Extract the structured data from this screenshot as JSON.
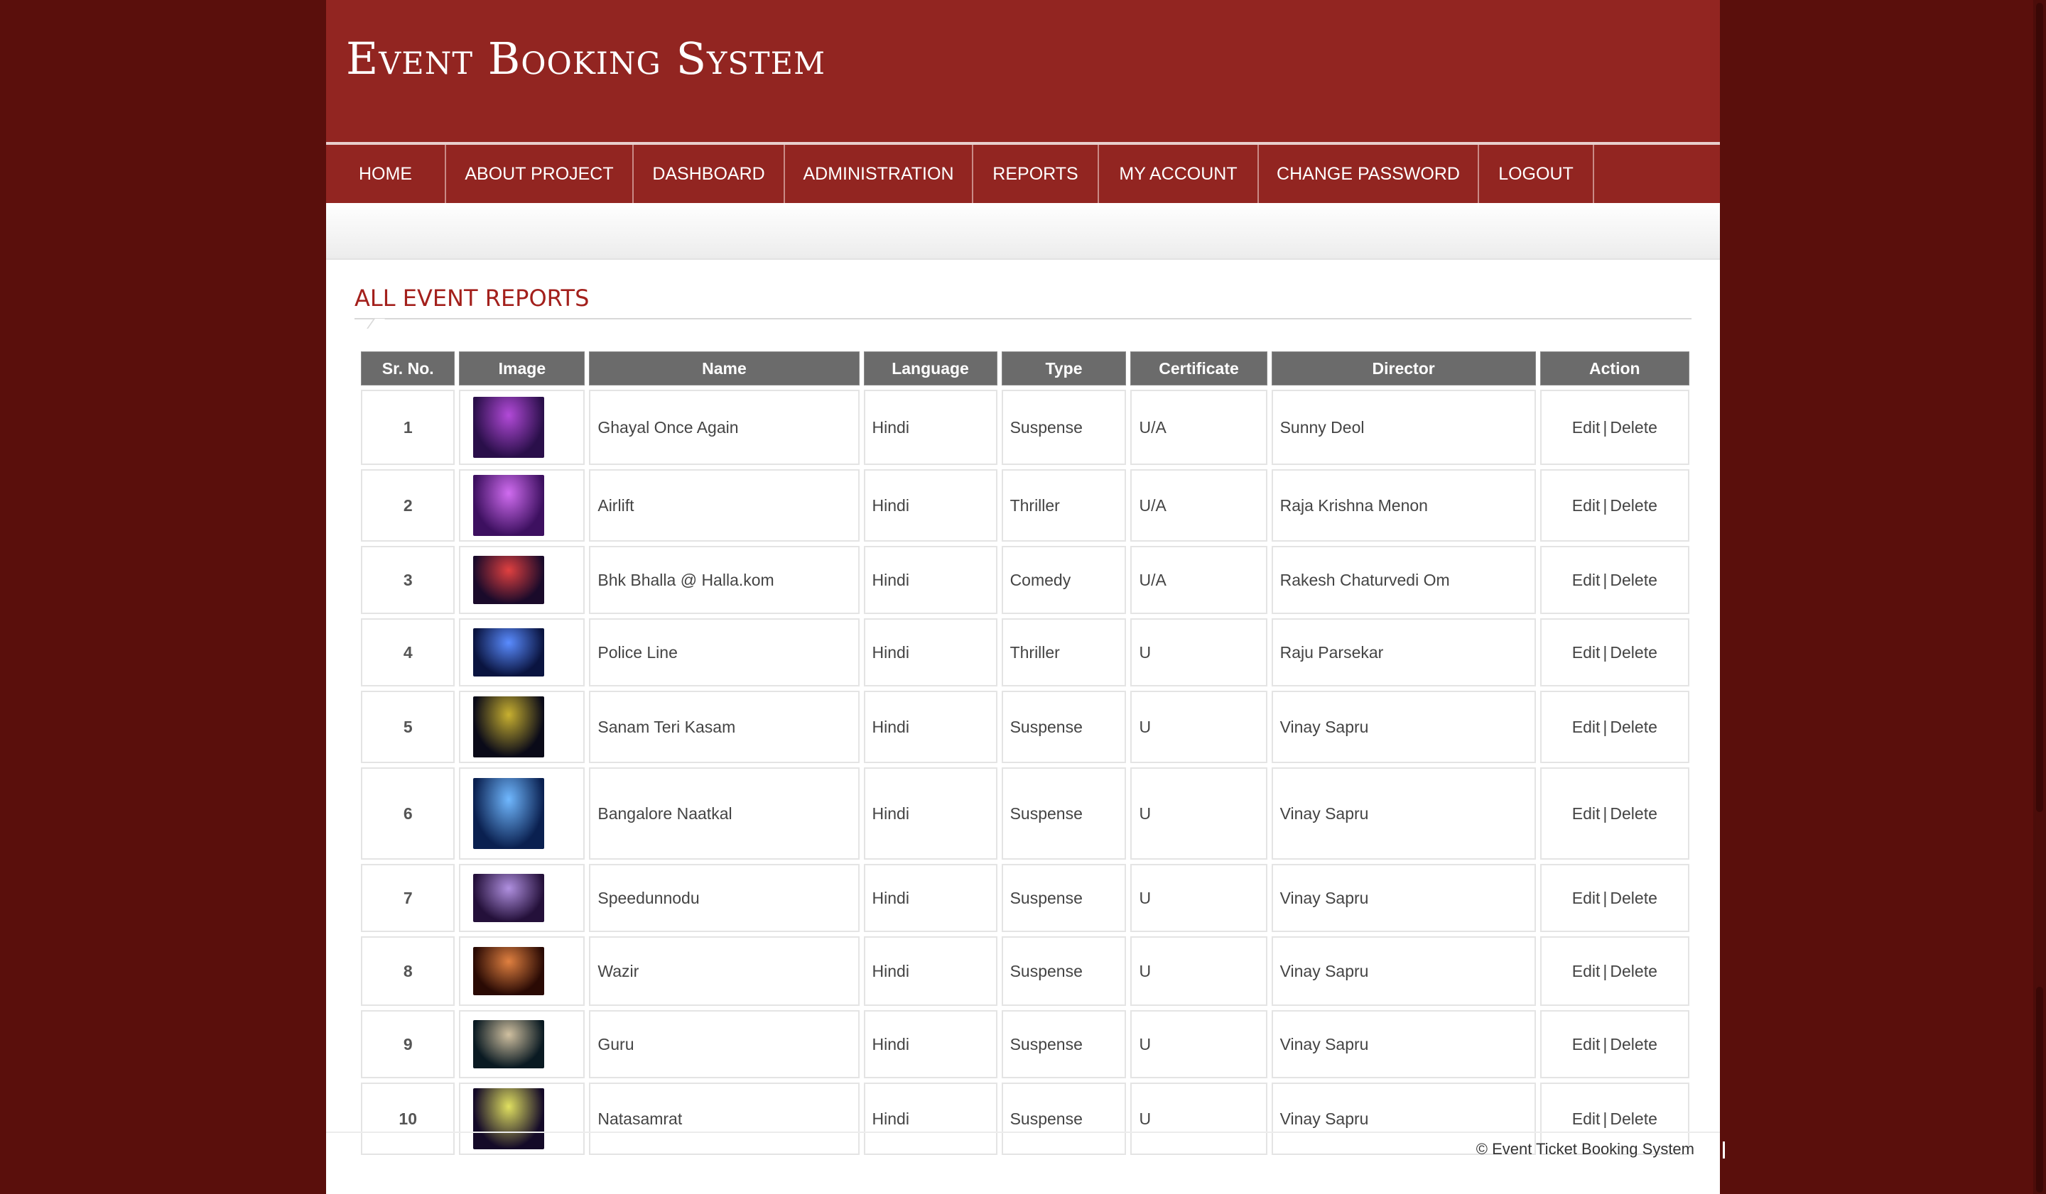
{
  "header": {
    "title": "Event Booking System"
  },
  "nav": {
    "items": [
      {
        "label": "HOME"
      },
      {
        "label": "ABOUT PROJECT"
      },
      {
        "label": "DASHBOARD"
      },
      {
        "label": "ADMINISTRATION"
      },
      {
        "label": "REPORTS"
      },
      {
        "label": "MY ACCOUNT"
      },
      {
        "label": "CHANGE PASSWORD"
      },
      {
        "label": "LOGOUT"
      }
    ]
  },
  "main": {
    "section_title": "ALL EVENT REPORTS",
    "table": {
      "headers": {
        "sr": "Sr. No.",
        "image": "Image",
        "name": "Name",
        "language": "Language",
        "type": "Type",
        "certificate": "Certificate",
        "director": "Director",
        "action": "Action"
      },
      "edit_label": "Edit",
      "separator": "|",
      "delete_label": "Delete",
      "rows": [
        {
          "sr": "1",
          "name": "Ghayal Once Again",
          "language": "Hindi",
          "type": "Suspense",
          "certificate": "U/A",
          "director": "Sunny Deol",
          "thumb_colors": [
            "#2a0f4a",
            "#b24ad8"
          ]
        },
        {
          "sr": "2",
          "name": "Airlift",
          "language": "Hindi",
          "type": "Thriller",
          "certificate": "U/A",
          "director": "Raja Krishna Menon",
          "thumb_colors": [
            "#3d1060",
            "#d06cf0"
          ]
        },
        {
          "sr": "3",
          "name": "Bhk Bhalla @ Halla.kom",
          "language": "Hindi",
          "type": "Comedy",
          "certificate": "U/A",
          "director": "Rakesh Chaturvedi Om",
          "thumb_colors": [
            "#1a0a2a",
            "#e04040"
          ]
        },
        {
          "sr": "4",
          "name": "Police Line",
          "language": "Hindi",
          "type": "Thriller",
          "certificate": "U",
          "director": "Raju Parsekar",
          "thumb_colors": [
            "#0a1440",
            "#5a8cff"
          ]
        },
        {
          "sr": "5",
          "name": "Sanam Teri Kasam",
          "language": "Hindi",
          "type": "Suspense",
          "certificate": "U",
          "director": "Vinay Sapru",
          "thumb_colors": [
            "#0a0a18",
            "#c8b030"
          ]
        },
        {
          "sr": "6",
          "name": "Bangalore Naatkal",
          "language": "Hindi",
          "type": "Suspense",
          "certificate": "U",
          "director": "Vinay Sapru",
          "thumb_colors": [
            "#0a2050",
            "#70b8ff"
          ]
        },
        {
          "sr": "7",
          "name": "Speedunnodu",
          "language": "Hindi",
          "type": "Suspense",
          "certificate": "U",
          "director": "Vinay Sapru",
          "thumb_colors": [
            "#24103a",
            "#b090e0"
          ]
        },
        {
          "sr": "8",
          "name": "Wazir",
          "language": "Hindi",
          "type": "Suspense",
          "certificate": "U",
          "director": "Vinay Sapru",
          "thumb_colors": [
            "#2a0a04",
            "#e08040"
          ]
        },
        {
          "sr": "9",
          "name": "Guru",
          "language": "Hindi",
          "type": "Suspense",
          "certificate": "U",
          "director": "Vinay Sapru",
          "thumb_colors": [
            "#0a1a22",
            "#d0c0a0"
          ]
        },
        {
          "sr": "10",
          "name": "Natasamrat",
          "language": "Hindi",
          "type": "Suspense",
          "certificate": "U",
          "director": "Vinay Sapru",
          "thumb_colors": [
            "#140a28",
            "#e0e060"
          ]
        }
      ]
    }
  },
  "footer": {
    "text": "© Event Ticket Booking System"
  },
  "colors": {
    "brand": "#922521",
    "page_background": "#5a0f0c",
    "header_cell": "#6b6b6b",
    "section_title": "#a3201c"
  }
}
